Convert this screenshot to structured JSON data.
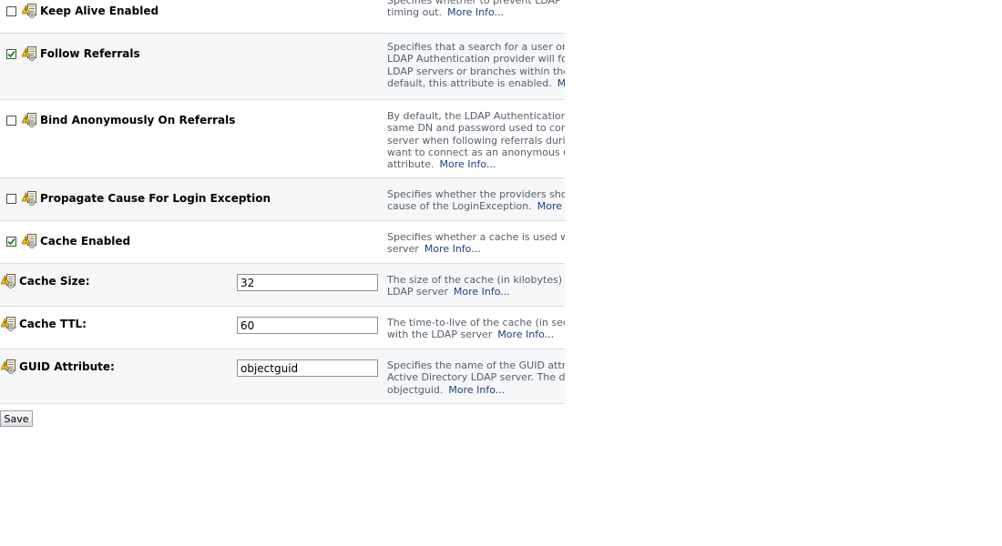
{
  "rows": [
    {
      "type": "checkbox",
      "label": "Keep Alive Enabled",
      "checked": false,
      "desc_lines": [
        "Specifies whether to prevent LDAP conn",
        "timing out."
      ],
      "more": "More Info..."
    },
    {
      "type": "checkbox",
      "label": "Follow Referrals",
      "checked": true,
      "desc_lines": [
        "Specifies that a search for a user or grou",
        "LDAP Authentication provider will follow r",
        "LDAP servers or branches within the LDA",
        "default, this attribute is enabled."
      ],
      "more": "More"
    },
    {
      "type": "checkbox",
      "label": "Bind Anonymously On Referrals",
      "checked": false,
      "desc_lines": [
        "By default, the LDAP Authentication prov",
        "same DN and password used to connect",
        "server when following referrals during a",
        "want to connect as an anonymous user,",
        "attribute."
      ],
      "more": "More Info..."
    },
    {
      "type": "checkbox",
      "label": "Propagate Cause For Login Exception",
      "checked": false,
      "desc_lines": [
        "Specifies whether the providers should p",
        "cause of the LoginException."
      ],
      "more": "More Info"
    },
    {
      "type": "checkbox",
      "label": "Cache Enabled",
      "checked": true,
      "desc_lines": [
        "Specifies whether a cache is used with th",
        "server"
      ],
      "more": "More Info..."
    },
    {
      "type": "text",
      "label": "Cache Size:",
      "value": "32",
      "desc_lines": [
        "The size of the cache (in kilobytes) that i",
        "LDAP server"
      ],
      "more": "More Info..."
    },
    {
      "type": "text",
      "label": "Cache TTL:",
      "value": "60",
      "desc_lines": [
        "The time-to-live of the cache (in seconds",
        "with the LDAP server"
      ],
      "more": "More Info..."
    },
    {
      "type": "text",
      "label": "GUID Attribute:",
      "value": "objectguid",
      "desc_lines": [
        "Specifies the name of the GUID attribute",
        "Active Directory LDAP server. The defau",
        "objectguid."
      ],
      "more": "More Info..."
    }
  ],
  "save_label": "Save",
  "icons": {
    "attribute": "config-attribute-icon",
    "check": "checkmark-icon"
  },
  "colors": {
    "check": "#1c8a1c",
    "link": "#1f3f82",
    "desc": "#56606a",
    "alt_row": "#f6f7f8"
  }
}
